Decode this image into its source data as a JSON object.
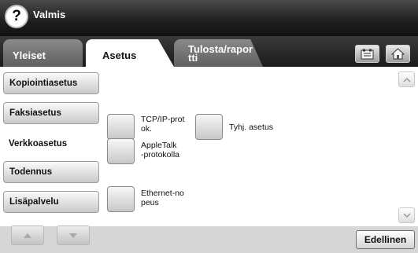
{
  "header": {
    "help_icon": "question-mark-icon",
    "help_glyph": "?",
    "status": "Valmis"
  },
  "tabs": [
    {
      "label": "Yleiset",
      "active": false
    },
    {
      "label": "Asetus",
      "active": true
    },
    {
      "label": "Tulosta/rapor\ntti",
      "active": false
    }
  ],
  "header_buttons": {
    "address_book_icon": "address-book-icon",
    "home_icon": "home-icon"
  },
  "sidebar": {
    "items": [
      {
        "label": "Kopiointiasetus",
        "active": false
      },
      {
        "label": "Faksiasetus",
        "active": false
      },
      {
        "label": "Verkkoasetus",
        "active": true
      },
      {
        "label": "Todennus",
        "active": false
      },
      {
        "label": "Lisäpalvelu",
        "active": false
      }
    ],
    "up_icon": "triangle-up-icon",
    "down_icon": "triangle-down-icon"
  },
  "options": [
    {
      "label": "TCP/IP-prot\nok."
    },
    {
      "label": "Tyhj. asetus"
    },
    {
      "label": "AppleTalk\n-protokolla"
    },
    {
      "label": "Ethernet-no\npeus"
    }
  ],
  "scroll": {
    "up_icon": "chevron-up-icon",
    "down_icon": "chevron-down-icon"
  },
  "back_button": {
    "label": "Edellinen"
  }
}
